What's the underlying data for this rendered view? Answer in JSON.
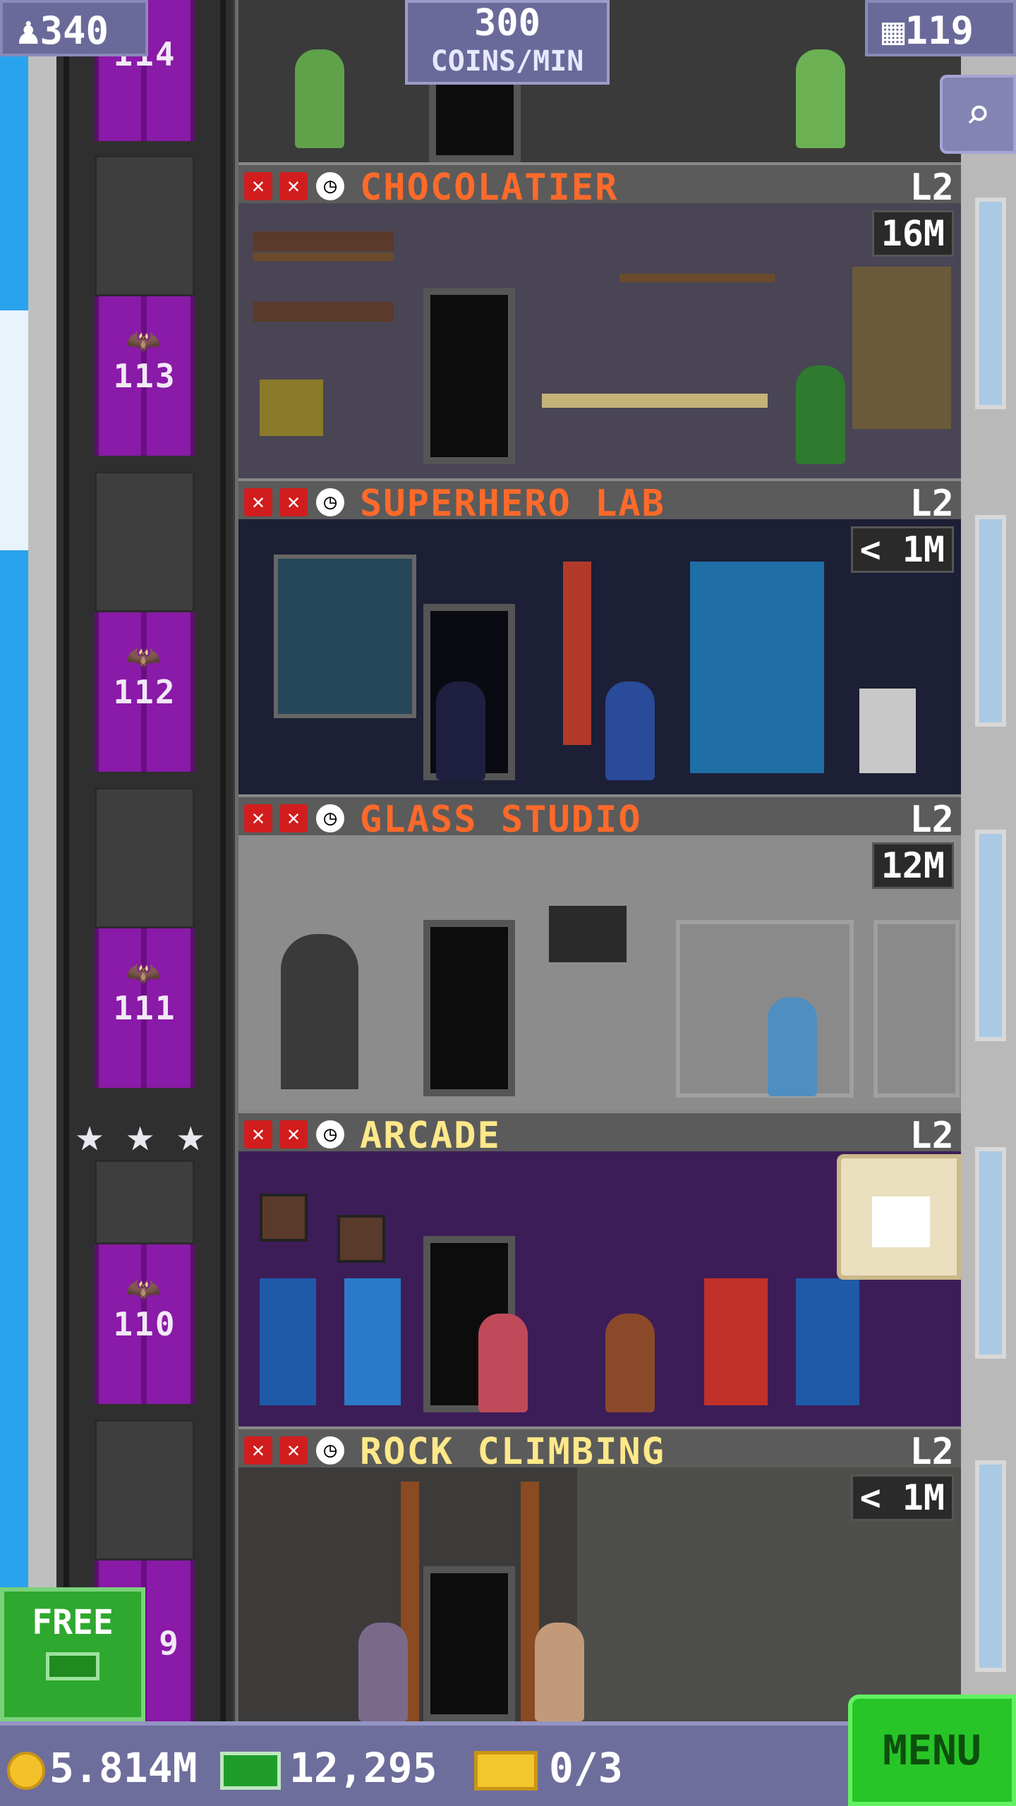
{
  "hud": {
    "population": "340",
    "coins_rate_value": "300",
    "coins_rate_unit": "COINS/MIN",
    "floors_count": "119"
  },
  "elevator": {
    "partial_top_number": "114",
    "numbers": [
      "113",
      "112",
      "111",
      "110"
    ],
    "partial_bottom_number": "9"
  },
  "floors": [
    {
      "name": "CHOCOLATIER",
      "level": "L2",
      "timer": "16M",
      "name_color": "#ff6a2a"
    },
    {
      "name": "SUPERHERO LAB",
      "level": "L2",
      "timer": "< 1M",
      "name_color": "#ff6a2a"
    },
    {
      "name": "GLASS STUDIO",
      "level": "L2",
      "timer": "12M",
      "name_color": "#ff6a2a"
    },
    {
      "name": "ARCADE",
      "level": "L2",
      "timer": "",
      "name_color": "#ffe889"
    },
    {
      "name": "ROCK CLIMBING",
      "level": "L2",
      "timer": "< 1M",
      "name_color": "#ffe889"
    }
  ],
  "free_button": {
    "label": "FREE"
  },
  "bottom_bar": {
    "coins": "5.814M",
    "tower_bux": "12,295",
    "tickets": "0/3",
    "menu_label": "MENU"
  },
  "icons": {
    "population": "person-icon",
    "floors": "building-icon",
    "search": "magnifier-icon",
    "chest": "chest-icon",
    "coin": "coin-icon",
    "bux": "bux-icon",
    "ticket": "ticket-icon"
  },
  "colors": {
    "menu_green": "#27c527",
    "elevator_purple": "#8a1aa8",
    "hud_bg": "#6e6e9c",
    "not_stocked_red": "#d11d1d"
  }
}
